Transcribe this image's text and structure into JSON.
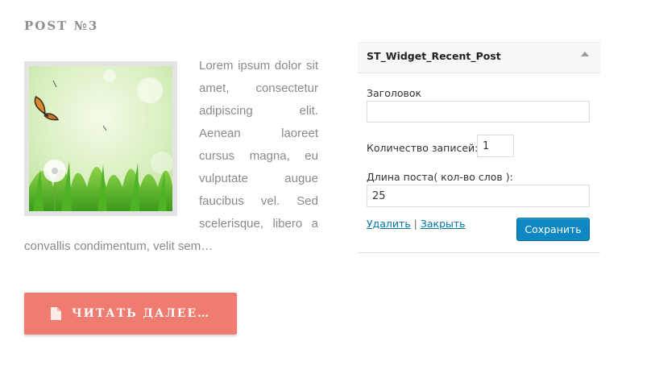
{
  "post": {
    "title": "POST №3",
    "excerpt": "Lorem ipsum dolor sit amet, consectetur adipiscing elit. Aenean laoreet cursus magna, eu vulputate augue faucibus vel. Sed scelerisque, libero a convallis condimentum, velit sem…",
    "read_more_label": "ЧИТАТЬ ДАЛЕЕ…",
    "read_more_icon": "document-icon",
    "accent_color": "#f07b70"
  },
  "widget": {
    "title": "ST_Widget_Recent_Post",
    "fields": {
      "heading_label": "Заголовок",
      "heading_value": "",
      "count_label": "Количество записей:",
      "count_value": "1",
      "length_label": "Длина поста( кол-во слов ):",
      "length_value": "25"
    },
    "delete_label": "Удалить",
    "separator": "|",
    "close_label": "Закрыть",
    "save_label": "Сохранить",
    "save_color": "#0e87c2"
  }
}
